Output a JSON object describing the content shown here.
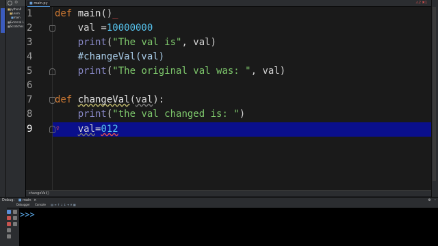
{
  "project": {
    "items": [
      "pythonP",
      "Learn",
      "main",
      "External L",
      "Scratches"
    ]
  },
  "editor": {
    "tab_label": "main.py",
    "inspection_summary": "⚠2 ✖1",
    "current_line": 9,
    "lines": [
      {
        "n": "1"
      },
      {
        "n": "2"
      },
      {
        "n": "3"
      },
      {
        "n": "4"
      },
      {
        "n": "5"
      },
      {
        "n": "6"
      },
      {
        "n": "7"
      },
      {
        "n": "8"
      },
      {
        "n": "9"
      }
    ],
    "code": {
      "l1_kw": "def ",
      "l1_name": "main",
      "l1_paren": "()",
      "l1_caret": "_",
      "l2_lhs": "    val =",
      "l2_num": "10000000",
      "l3_fn": "    print",
      "l3_open": "(",
      "l3_str": "\"The val is\"",
      "l3_rest": ", val)",
      "l4_comment": "    #changeVal(val)",
      "l5_fn": "    print",
      "l5_open": "(",
      "l5_str": "\"The original val was: \"",
      "l5_rest": ", val)",
      "l7_kw": "def ",
      "l7_name": "changeVal",
      "l7_open": "(",
      "l7_param": "val",
      "l7_rest": "):",
      "l8_fn": "    print",
      "l8_open": "(",
      "l8_str": "\"the val changed is: \"",
      "l8_rest": ")",
      "l9_indent": "    ",
      "l9_var": "val",
      "l9_eq": "=",
      "l9_num": "012"
    }
  },
  "breadcrumb": "changeVal()",
  "debug": {
    "title": "Debug:",
    "run_config": "main",
    "tabs": [
      "Debugger",
      "Console"
    ],
    "prompt": ">>>"
  }
}
